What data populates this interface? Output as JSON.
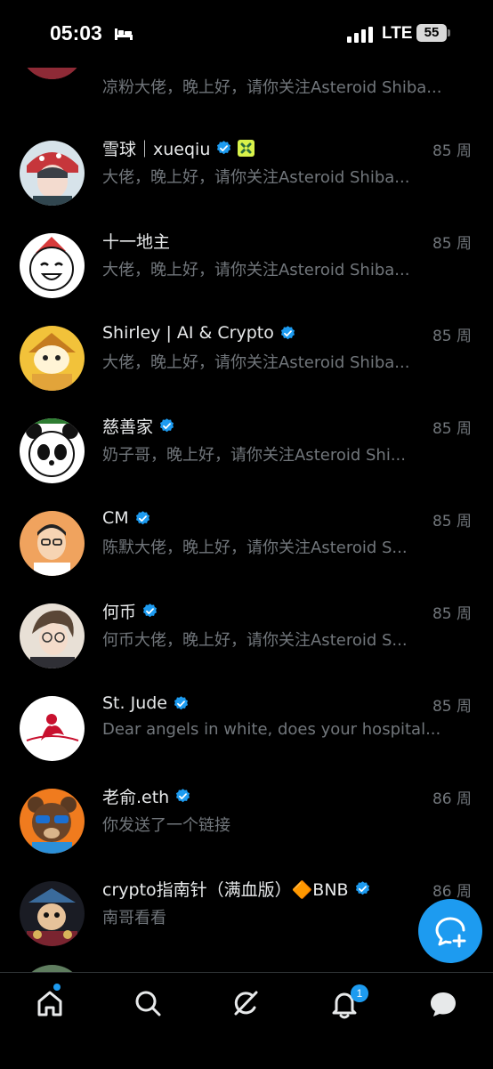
{
  "status_bar": {
    "time": "05:03",
    "network": "LTE",
    "battery": "55"
  },
  "colors": {
    "accent": "#1d9bf0",
    "background": "#000000",
    "secondary_text": "#71767b"
  },
  "conversations": [
    {
      "name": "",
      "verified": false,
      "when": "",
      "preview": "凉粉大佬，晚上好，请你关注Asteroid Shiba..."
    },
    {
      "name": "雪球｜xueqiu",
      "verified": true,
      "extra_badge": "yellow-x-badge",
      "when": "85 周",
      "preview": "大佬，晚上好，请你关注Asteroid Shiba..."
    },
    {
      "name": "十一地主",
      "verified": false,
      "when": "85 周",
      "preview": "大佬，晚上好，请你关注Asteroid Shiba..."
    },
    {
      "name": "Shirley | AI & Crypto",
      "verified": true,
      "when": "85 周",
      "preview": "大佬，晚上好，请你关注Asteroid Shiba..."
    },
    {
      "name": "慈善家",
      "verified": true,
      "when": "85 周",
      "preview": "奶子哥，晚上好，请你关注Asteroid Shi..."
    },
    {
      "name": "CM",
      "verified": true,
      "when": "85 周",
      "preview": "陈默大佬，晚上好，请你关注Asteroid S..."
    },
    {
      "name": "何币",
      "verified": true,
      "when": "85 周",
      "preview": "何币大佬，晚上好，请你关注Asteroid S..."
    },
    {
      "name": "St. Jude",
      "verified": true,
      "when": "85 周",
      "preview": "Dear angels in white, does your hospital..."
    },
    {
      "name": "老俞.eth",
      "verified": true,
      "when": "86 周",
      "preview": "你发送了一个链接"
    },
    {
      "name": "crypto指南针（满血版）🔶BNB",
      "verified": true,
      "when": "86 周",
      "preview": "南哥看看"
    }
  ],
  "bottom_nav": {
    "items": [
      "home-icon",
      "search-icon",
      "grok-icon",
      "notifications-icon",
      "messages-icon"
    ],
    "notification_count": "1"
  },
  "fab_icon": "new-message-icon"
}
